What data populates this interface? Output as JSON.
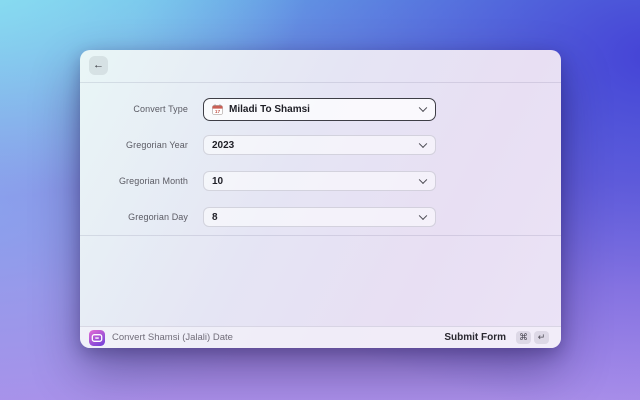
{
  "header": {
    "back_icon": "←"
  },
  "form": {
    "fields": [
      {
        "label": "Convert Type",
        "value": "Miladi To Shamsi",
        "icon": "calendar-emoji",
        "focused": true
      },
      {
        "label": "Gregorian Year",
        "value": "2023"
      },
      {
        "label": "Gregorian Month",
        "value": "10"
      },
      {
        "label": "Gregorian Day",
        "value": "8"
      }
    ]
  },
  "footer": {
    "command_name": "Convert Shamsi (Jalali) Date",
    "submit_label": "Submit Form",
    "shortcut_keys": [
      "⌘",
      "↵"
    ]
  },
  "icons": {
    "extension": "shamsi-jalali-extension-logo",
    "field_chevron": "chevron-down"
  },
  "colors": {
    "desktop_top_left": "#8ce2f2",
    "desktop_top_right": "#4543d6",
    "desktop_bottom": "#ab90ea",
    "window_bg_start": "#e9f6f6",
    "window_bg_end": "#ebe3f6",
    "focus_border": "#3e3e46",
    "extension_icon_top": "#e06ad4",
    "extension_icon_bottom": "#7a44d8",
    "calendar_icon_red": "#cb5f55"
  }
}
